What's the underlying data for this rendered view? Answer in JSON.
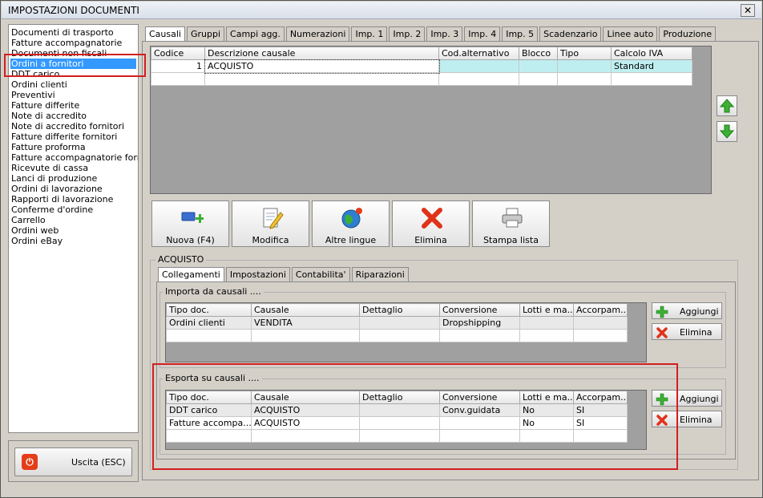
{
  "window": {
    "title": "IMPOSTAZIONI DOCUMENTI",
    "close_label": "✕"
  },
  "left_list": [
    "Documenti di trasporto",
    "Fatture accompagnatorie",
    "Documenti non fiscali",
    "Ordini a fornitori",
    "DDT carico",
    "Ordini clienti",
    "Preventivi",
    "Fatture differite",
    "Note di accredito",
    "Note di accredito fornitori",
    "Fatture differite fornitori",
    "Fatture proforma",
    "Fatture accompagnatorie fornito",
    "Ricevute di cassa",
    "Lanci di produzione",
    "Ordini di lavorazione",
    "Rapporti di lavorazione",
    "Conferme d'ordine",
    "Carrello",
    "Ordini web",
    "Ordini eBay"
  ],
  "selected_index": 3,
  "exit_label": "Uscita (ESC)",
  "tabs": [
    "Causali",
    "Gruppi",
    "Campi agg.",
    "Numerazioni",
    "Imp. 1",
    "Imp. 2",
    "Imp. 3",
    "Imp. 4",
    "Imp. 5",
    "Scadenzario",
    "Linee auto",
    "Produzione"
  ],
  "active_tab": 0,
  "causali_grid": {
    "headers": [
      "Codice",
      "Descrizione causale",
      "Cod.alternativo",
      "Blocco",
      "Tipo",
      "Calcolo IVA"
    ],
    "rows": [
      [
        "1",
        "ACQUISTO",
        "",
        "",
        "",
        "Standard"
      ]
    ]
  },
  "actions": [
    "Nuova (F4)",
    "Modifica",
    "Altre lingue",
    "Elimina",
    "Stampa lista"
  ],
  "detail_title": "ACQUISTO",
  "sub_tabs": [
    "Collegamenti",
    "Impostazioni",
    "Contabilita'",
    "Riparazioni"
  ],
  "importa": {
    "title": "Importa da causali ....",
    "headers": [
      "Tipo doc.",
      "Causale",
      "Dettaglio",
      "Conversione",
      "Lotti e ma...",
      "Accorpam..."
    ],
    "rows": [
      [
        "Ordini clienti",
        "VENDITA",
        "",
        "Dropshipping",
        "",
        ""
      ]
    ]
  },
  "esporta": {
    "title": "Esporta su causali ....",
    "headers": [
      "Tipo doc.",
      "Causale",
      "Dettaglio",
      "Conversione",
      "Lotti e ma...",
      "Accorpam..."
    ],
    "rows": [
      [
        "DDT carico",
        "ACQUISTO",
        "",
        "Conv.guidata",
        "No",
        "SI"
      ],
      [
        "Fatture accompa...",
        "ACQUISTO",
        "",
        "",
        "No",
        "SI"
      ]
    ]
  },
  "side_buttons": {
    "add": "Aggiungi",
    "delete": "Elimina"
  },
  "colors": {
    "selection": "#3399ff",
    "row_highlight": "#bfeef0",
    "annotation_red": "#d21f1f"
  }
}
